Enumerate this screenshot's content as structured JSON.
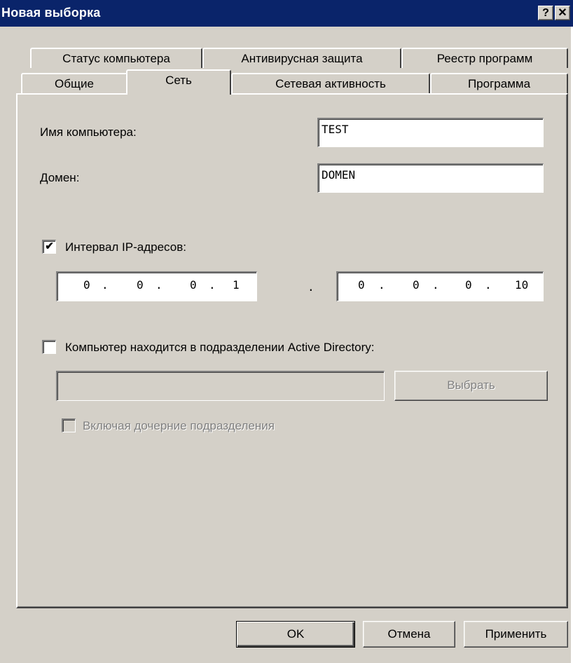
{
  "window": {
    "title": "Новая выборка",
    "help_label": "?",
    "close_label": "✕"
  },
  "tabs": {
    "row1": [
      {
        "label": "Статус компьютера"
      },
      {
        "label": "Антивирусная защита"
      },
      {
        "label": "Реестр программ"
      }
    ],
    "row2": [
      {
        "label": "Общие"
      },
      {
        "label": "Сеть",
        "active": true
      },
      {
        "label": "Сетевая активность"
      },
      {
        "label": "Программа"
      }
    ]
  },
  "form": {
    "computer_name": {
      "label": "Имя компьютера:",
      "value": "TEST"
    },
    "domain": {
      "label": "Домен:",
      "value": "DOMEN"
    },
    "ip_range": {
      "label": "Интервал IP-адресов:",
      "checked": true,
      "check_mark": "✔",
      "from": [
        "0",
        "0",
        "0",
        "1"
      ],
      "to": [
        "0",
        "0",
        "0",
        "10"
      ],
      "octet_separator": ".",
      "range_separator": "."
    },
    "ad_unit": {
      "label": "Компьютер находится в подразделении Active Directory:",
      "checked": false,
      "value": "",
      "choose_label": "Выбрать",
      "include_children_label": "Включая дочерние подразделения",
      "include_children_checked": false
    }
  },
  "buttons": {
    "ok": "OK",
    "cancel": "Отмена",
    "apply": "Применить"
  },
  "colors": {
    "titlebar": "#0a246a",
    "face": "#d4d0c8",
    "disabled_text": "#808080"
  }
}
